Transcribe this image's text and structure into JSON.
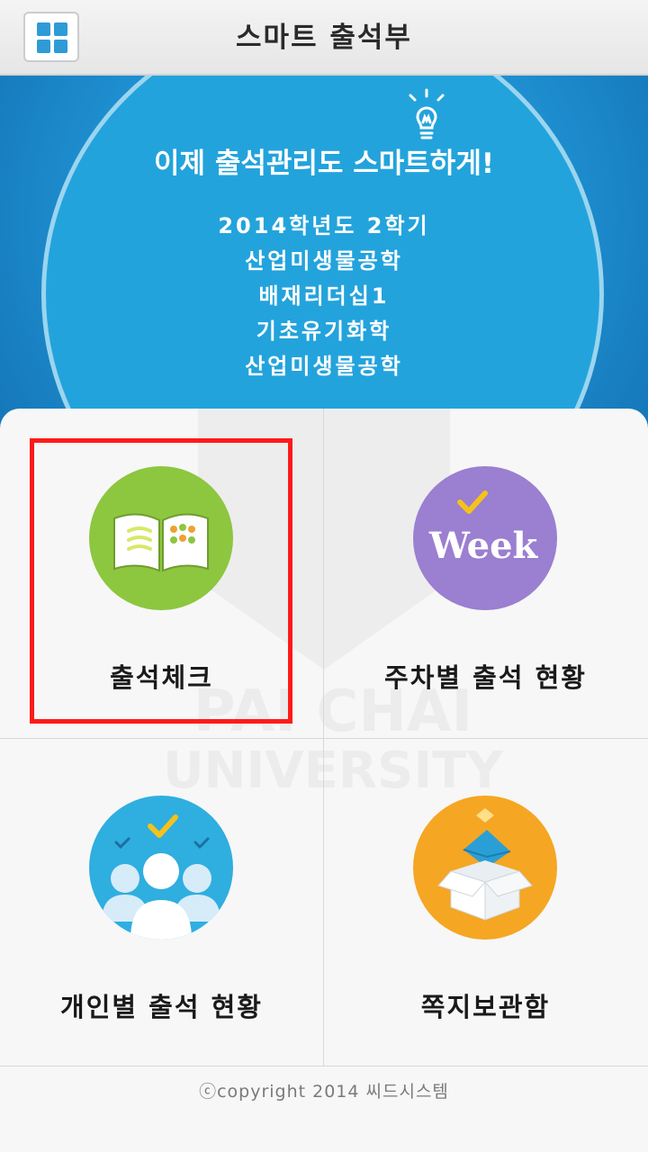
{
  "header": {
    "title": "스마트 출석부",
    "menu_icon": "grid-icon"
  },
  "banner": {
    "headline": "이제 출석관리도 스마트하게!",
    "icon": "lightbulb-icon",
    "courses": [
      "2014학년도 2학기",
      "산업미생물공학",
      "배재리더십1",
      "기초유기화학",
      "산업미생물공학"
    ]
  },
  "watermark": {
    "line1": "PAI CHAI",
    "line2": "UNIVERSITY"
  },
  "menu": {
    "items": [
      {
        "label": "출석체크",
        "icon": "open-book-icon",
        "color": "#8dc63f",
        "selected": true
      },
      {
        "label": "주차별 출석 현황",
        "icon": "week-check-icon",
        "color": "#9b7fd0",
        "icon_text": "Week"
      },
      {
        "label": "개인별 출석 현황",
        "icon": "people-check-icon",
        "color": "#2faee0"
      },
      {
        "label": "쪽지보관함",
        "icon": "mail-box-icon",
        "color": "#f5a623"
      }
    ]
  },
  "footer": {
    "copyright": "ⓒcopyright 2014 씨드시스템"
  }
}
